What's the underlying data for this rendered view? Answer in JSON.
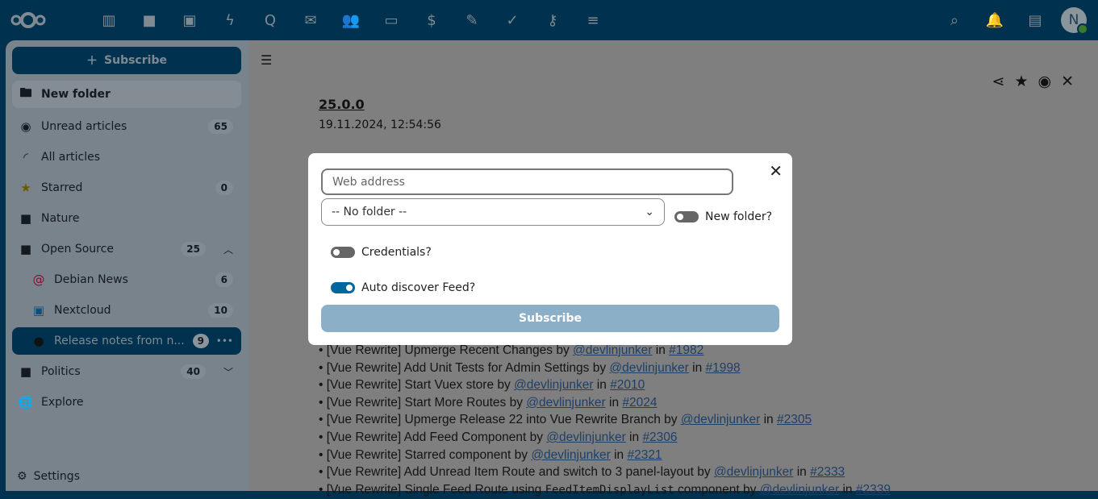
{
  "topbar": {
    "apps": [
      "dashboard-icon",
      "files-icon",
      "photos-icon",
      "activity-icon",
      "talk-icon",
      "mail-icon",
      "contacts-icon",
      "calendar-icon",
      "money-icon",
      "notes-icon",
      "tasks-icon",
      "passwords-icon",
      "news-icon"
    ],
    "avatar": "N"
  },
  "sidebar": {
    "subscribe": "Subscribe",
    "items": [
      {
        "label": "New folder"
      },
      {
        "label": "Unread articles",
        "count": "65"
      },
      {
        "label": "All articles"
      },
      {
        "label": "Starred",
        "count": "0"
      },
      {
        "label": "Nature"
      },
      {
        "label": "Open Source",
        "count": "25"
      },
      {
        "label": "Debian News",
        "count": "6"
      },
      {
        "label": "Nextcloud",
        "count": "10"
      },
      {
        "label": "Release notes from n...",
        "count": "9"
      },
      {
        "label": "Politics",
        "count": "40"
      },
      {
        "label": "Explore"
      }
    ],
    "settings": "Settings"
  },
  "article": {
    "title": "25.0.0",
    "date": "19.11.2024, 12:54:56",
    "items": [
      {
        "text": "[Vue Rewrite] Upmerge Recent Changes by ",
        "user": "@devlinjunker",
        "in": " in ",
        "pr": "#1982"
      },
      {
        "text": "[Vue Rewrite] Add Unit Tests for Admin Settings by ",
        "user": "@devlinjunker",
        "in": " in ",
        "pr": "#1998"
      },
      {
        "text": "[Vue Rewrite] Start Vuex store by ",
        "user": "@devlinjunker",
        "in": " in ",
        "pr": "#2010"
      },
      {
        "text": "[Vue Rewrite] Start More Routes by ",
        "user": "@devlinjunker",
        "in": " in ",
        "pr": "#2024"
      },
      {
        "text": "[Vue Rewrite] Upmerge Release 22 into Vue Rewrite Branch by ",
        "user": "@devlinjunker",
        "in": " in ",
        "pr": "#2305"
      },
      {
        "text": "[Vue Rewrite] Add Feed Component by ",
        "user": "@devlinjunker",
        "in": " in ",
        "pr": "#2306"
      },
      {
        "text": "[Vue Rewrite] Starred component by ",
        "user": "@devlinjunker",
        "in": " in ",
        "pr": "#2321"
      },
      {
        "text": "[Vue Rewrite] Add Unread Item Route and switch to 3 panel-layout by ",
        "user": "@devlinjunker",
        "in": " in ",
        "pr": "#2333"
      }
    ],
    "last": {
      "text": "[Vue Rewrite] Single Feed Route using ",
      "code": "FeedItemDisplayList",
      "text2": " component by ",
      "user": "@devlinjunker",
      "in": " in ",
      "pr": "#2339"
    }
  },
  "modal": {
    "url_placeholder": "Web address",
    "folder": "-- No folder --",
    "new_folder": "New folder?",
    "credentials": "Credentials?",
    "autodiscover": "Auto discover Feed?",
    "submit": "Subscribe",
    "autodiscover_on": true,
    "credentials_on": false,
    "new_folder_on": false
  }
}
